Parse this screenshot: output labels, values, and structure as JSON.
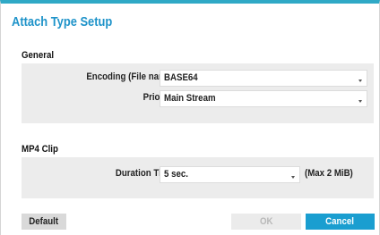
{
  "dialog": {
    "title": "Attach Type Setup"
  },
  "general": {
    "section_label": "General",
    "encoding": {
      "label": "Encoding (File name)",
      "value": "BASE64"
    },
    "priority": {
      "label": "Priority",
      "value": "Main Stream"
    }
  },
  "mp4_clip": {
    "section_label": "MP4 Clip",
    "duration": {
      "label": "Duration Time",
      "value": "5 sec.",
      "note": "(Max 2 MiB)"
    }
  },
  "footer": {
    "default_label": "Default",
    "ok_label": "OK",
    "ok_disabled": true,
    "cancel_label": "Cancel"
  },
  "colors": {
    "accent": "#1e93c9",
    "header_bar": "#2fa9c6",
    "cancel_button": "#1a9ed0",
    "panel_bg": "#ececec"
  },
  "icons": {
    "dropdown": "chevron-down-icon"
  }
}
